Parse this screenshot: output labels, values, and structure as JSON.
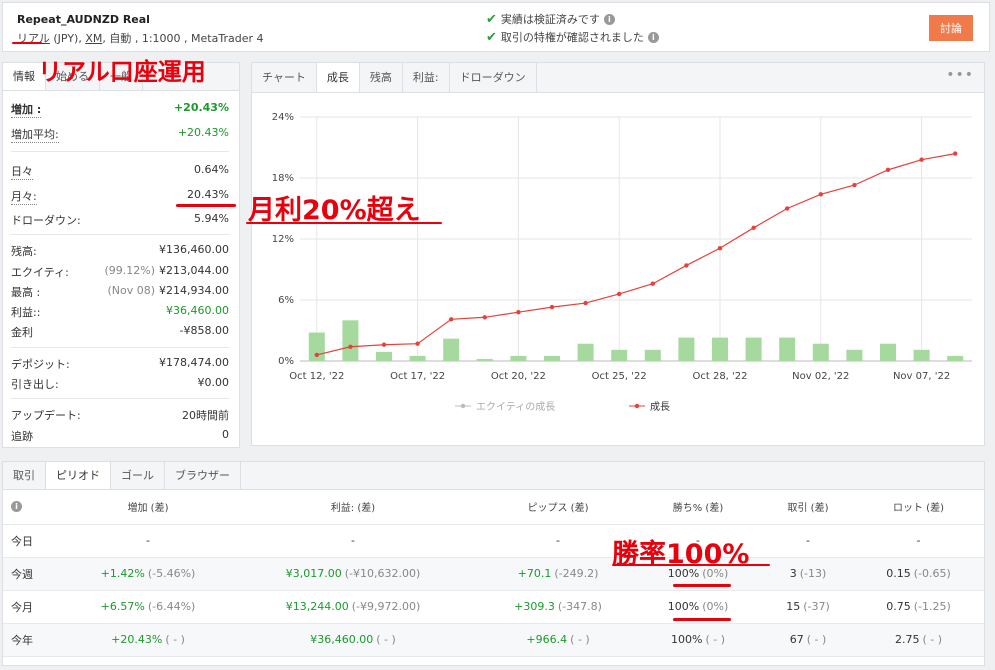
{
  "header": {
    "title": "Repeat_AUDNZD Real",
    "type": "リアル",
    "currency": "(JPY),",
    "broker": "XM",
    "rest": ", 自動 , 1:1000 , MetaTrader 4",
    "verified1": "実績は検証済みです",
    "verified2": "取引の特権が確認されました",
    "discuss": "討論"
  },
  "stats": {
    "tabs": [
      "情報",
      "始める",
      "一般"
    ],
    "gain_label": "増加 :",
    "gain_value": "+20.43%",
    "abs_label": "増加平均:",
    "abs_value": "+20.43%",
    "daily_label": "日々",
    "daily_value": "0.64%",
    "monthly_label": "月々:",
    "monthly_value": "20.43%",
    "dd_label": "ドローダウン:",
    "dd_value": "5.94%",
    "balance_label": "残高:",
    "balance_value": "¥136,460.00",
    "equity_label": "エクイティ:",
    "equity_sub": "(99.12%)",
    "equity_value": "¥213,044.00",
    "highest_label": "最高 :",
    "highest_sub": "(Nov 08)",
    "highest_value": "¥214,934.00",
    "profit_label": "利益::",
    "profit_value": "¥36,460.00",
    "interest_label": "金利",
    "interest_value": "-¥858.00",
    "deposits_label": "デポジット:",
    "deposits_value": "¥178,474.00",
    "withdrawals_label": "引き出し:",
    "withdrawals_value": "¥0.00",
    "updated_label": "アップデート:",
    "updated_value": "20時間前",
    "tracking_label": "追跡",
    "tracking_value": "0"
  },
  "chart_tabs": [
    "チャート",
    "成長",
    "残高",
    "利益:",
    "ドローダウン"
  ],
  "chart_data": {
    "type": "line",
    "x_ticks": [
      "Oct 12, '22",
      "Oct 17, '22",
      "Oct 20, '22",
      "Oct 25, '22",
      "Oct 28, '22",
      "Nov 02, '22",
      "Nov 07, '22"
    ],
    "ylim": [
      0,
      24
    ],
    "y_ticks": [
      "0%",
      "6%",
      "12%",
      "18%",
      "24%"
    ],
    "series": [
      {
        "name": "成長",
        "color": "#e8403a",
        "values": [
          0.6,
          1.4,
          1.6,
          1.7,
          4.1,
          4.3,
          4.8,
          5.3,
          5.7,
          6.6,
          7.6,
          9.4,
          11.1,
          13.1,
          15.0,
          16.4,
          17.3,
          18.8,
          19.8,
          20.4
        ]
      }
    ],
    "bars": {
      "color": "#a6d99e",
      "values": [
        2.8,
        4.0,
        0.9,
        0.5,
        2.2,
        0.2,
        0.5,
        0.5,
        1.7,
        1.1,
        1.1,
        2.3,
        2.3,
        2.3,
        2.3,
        1.7,
        1.1,
        1.7,
        1.1,
        0.5
      ]
    },
    "legend": [
      "エクイティの成長",
      "成長"
    ]
  },
  "period": {
    "tabs": [
      "取引",
      "ピリオド",
      "ゴール",
      "ブラウザー"
    ],
    "headers": [
      "増加 (差)",
      "利益: (差)",
      "ピップス (差)",
      "勝ち% (差)",
      "取引 (差)",
      "ロット (差)"
    ],
    "rows": [
      {
        "name": "今日",
        "cells": [
          [
            "-",
            ""
          ],
          [
            "-",
            ""
          ],
          [
            "-",
            ""
          ],
          [
            "-",
            ""
          ],
          [
            "-",
            ""
          ],
          [
            "-",
            ""
          ]
        ]
      },
      {
        "name": "今週",
        "cells": [
          [
            "+1.42%",
            "(-5.46%)"
          ],
          [
            "¥3,017.00",
            "(-¥10,632.00)"
          ],
          [
            "+70.1",
            "(-249.2)"
          ],
          [
            "100%",
            "(0%)"
          ],
          [
            "3",
            "(-13)"
          ],
          [
            "0.15",
            "(-0.65)"
          ]
        ]
      },
      {
        "name": "今月",
        "cells": [
          [
            "+6.57%",
            "(-6.44%)"
          ],
          [
            "¥13,244.00",
            "(-¥9,972.00)"
          ],
          [
            "+309.3",
            "(-347.8)"
          ],
          [
            "100%",
            "(0%)"
          ],
          [
            "15",
            "(-37)"
          ],
          [
            "0.75",
            "(-1.25)"
          ]
        ]
      },
      {
        "name": "今年",
        "cells": [
          [
            "+20.43%",
            "( - )"
          ],
          [
            "¥36,460.00",
            "( - )"
          ],
          [
            "+966.4",
            "( - )"
          ],
          [
            "100%",
            "( - )"
          ],
          [
            "67",
            "( - )"
          ],
          [
            "2.75",
            "( - )"
          ]
        ]
      }
    ]
  },
  "annotations": {
    "real_account": "リアル口座運用",
    "monthly": "月利20%超え",
    "winrate": "勝率100%"
  }
}
